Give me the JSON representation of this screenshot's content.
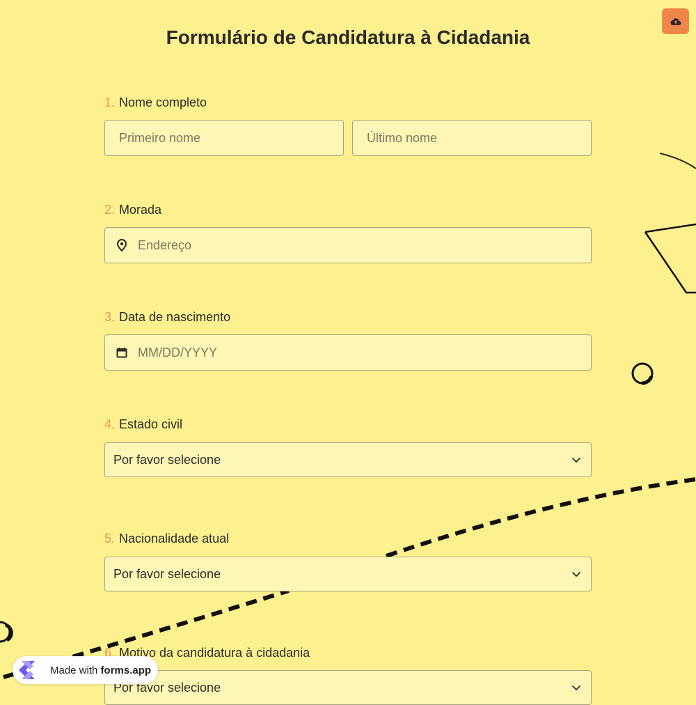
{
  "colors": {
    "background": "#fcf18e",
    "field_background": "#fef6b4",
    "accent_number": "#e8955a",
    "upload_button": "#f0874a"
  },
  "toolbar": {
    "upload_icon": "cloud-upload-icon"
  },
  "form": {
    "title": "Formulário de Candidatura à Cidadania",
    "questions": [
      {
        "number": "1.",
        "label": "Nome completo",
        "first_placeholder": "Primeiro nome",
        "last_placeholder": "Último nome"
      },
      {
        "number": "2.",
        "label": "Morada",
        "placeholder": "Endereço",
        "icon": "map-pin-icon"
      },
      {
        "number": "3.",
        "label": "Data de nascimento",
        "placeholder": "MM/DD/YYYY",
        "icon": "calendar-icon"
      },
      {
        "number": "4.",
        "label": "Estado civil",
        "selected": "Por favor selecione",
        "icon": "chevron-down-icon"
      },
      {
        "number": "5.",
        "label": "Nacionalidade atual",
        "selected": "Por favor selecione",
        "icon": "chevron-down-icon"
      },
      {
        "number": "6.",
        "label": "Motivo da candidatura à cidadania",
        "selected": "Por favor selecione",
        "icon": "chevron-down-icon"
      }
    ]
  },
  "badge": {
    "made_with": "Made with",
    "brand": "forms.app"
  }
}
